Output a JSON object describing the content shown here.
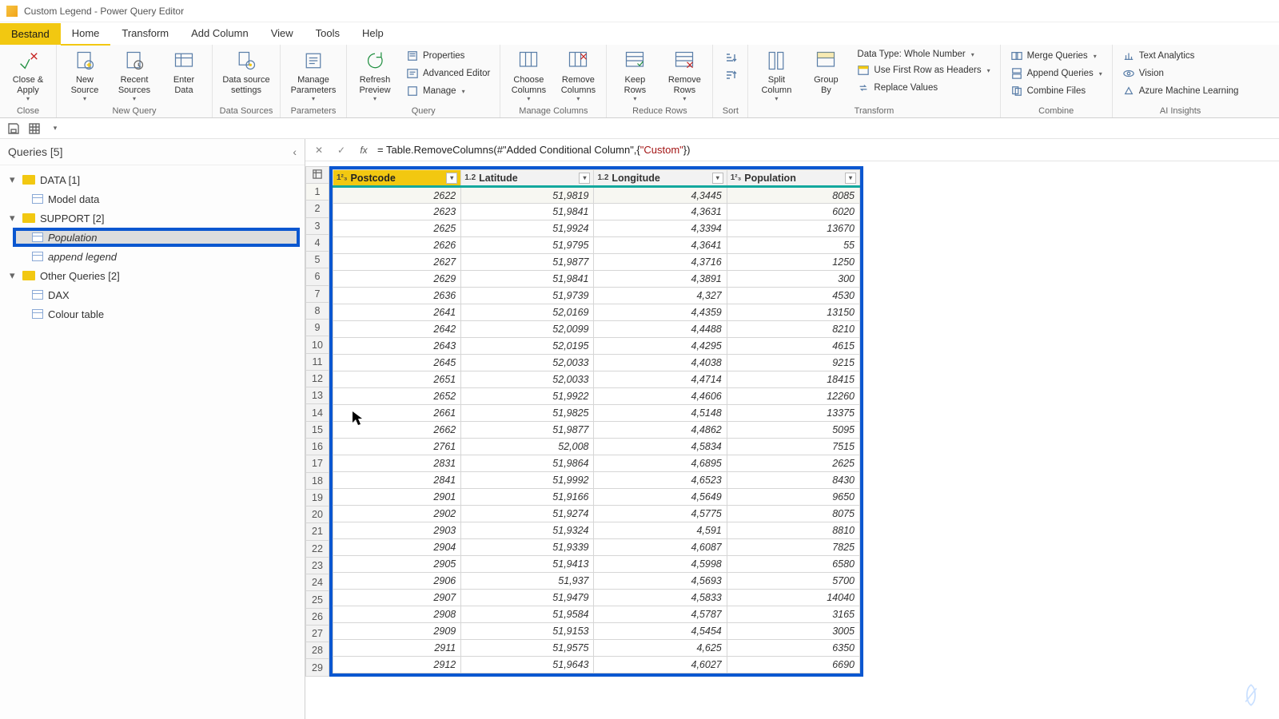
{
  "window": {
    "title": "Custom Legend - Power Query Editor"
  },
  "menu": {
    "file": "Bestand",
    "items": [
      "Home",
      "Transform",
      "Add Column",
      "View",
      "Tools",
      "Help"
    ],
    "active_index": 0
  },
  "ribbon": {
    "close": {
      "close_apply": "Close &\nApply",
      "group_label": "Close"
    },
    "new_query": {
      "new_source": "New\nSource",
      "recent_sources": "Recent\nSources",
      "enter_data": "Enter\nData",
      "group_label": "New Query"
    },
    "data_sources": {
      "settings": "Data source\nsettings",
      "group_label": "Data Sources"
    },
    "parameters": {
      "manage": "Manage\nParameters",
      "group_label": "Parameters"
    },
    "query": {
      "refresh": "Refresh\nPreview",
      "properties": "Properties",
      "advanced": "Advanced Editor",
      "manage": "Manage",
      "group_label": "Query"
    },
    "manage_columns": {
      "choose": "Choose\nColumns",
      "remove": "Remove\nColumns",
      "group_label": "Manage Columns"
    },
    "reduce_rows": {
      "keep": "Keep\nRows",
      "remove": "Remove\nRows",
      "group_label": "Reduce Rows"
    },
    "sort": {
      "group_label": "Sort"
    },
    "transform": {
      "split": "Split\nColumn",
      "group_by": "Group\nBy",
      "data_type": "Data Type: Whole Number",
      "first_row": "Use First Row as Headers",
      "replace": "Replace Values",
      "group_label": "Transform"
    },
    "combine": {
      "merge": "Merge Queries",
      "append": "Append Queries",
      "combine_files": "Combine Files",
      "group_label": "Combine"
    },
    "ai": {
      "text": "Text Analytics",
      "vision": "Vision",
      "ml": "Azure Machine Learning",
      "group_label": "AI Insights"
    }
  },
  "queries_pane": {
    "title": "Queries [5]",
    "groups": [
      {
        "label": "DATA [1]",
        "expanded": true,
        "items": [
          {
            "label": "Model data",
            "italic": false
          }
        ]
      },
      {
        "label": "SUPPORT [2]",
        "expanded": true,
        "items": [
          {
            "label": "Population",
            "italic": true,
            "selected": true
          },
          {
            "label": "append legend",
            "italic": true
          }
        ]
      },
      {
        "label": "Other Queries [2]",
        "expanded": true,
        "items": [
          {
            "label": "DAX",
            "italic": false
          },
          {
            "label": "Colour table",
            "italic": false
          }
        ]
      }
    ]
  },
  "formula": {
    "prefix": "= Table.RemoveColumns(#\"Added Conditional Column\",{",
    "string_literal": "\"Custom\"",
    "suffix": "})"
  },
  "grid": {
    "columns": [
      {
        "name": "Postcode",
        "type": "int",
        "selected": true
      },
      {
        "name": "Latitude",
        "type": "dec"
      },
      {
        "name": "Longitude",
        "type": "dec"
      },
      {
        "name": "Population",
        "type": "int"
      }
    ],
    "type_labels": {
      "int": "1²₃",
      "dec": "1.2"
    }
  },
  "chart_data": {
    "type": "table",
    "title": "Population",
    "columns": [
      "Postcode",
      "Latitude",
      "Longitude",
      "Population"
    ],
    "rows": [
      [
        "2622",
        "51,9819",
        "4,3445",
        "8085"
      ],
      [
        "2623",
        "51,9841",
        "4,3631",
        "6020"
      ],
      [
        "2625",
        "51,9924",
        "4,3394",
        "13670"
      ],
      [
        "2626",
        "51,9795",
        "4,3641",
        "55"
      ],
      [
        "2627",
        "51,9877",
        "4,3716",
        "1250"
      ],
      [
        "2629",
        "51,9841",
        "4,3891",
        "300"
      ],
      [
        "2636",
        "51,9739",
        "4,327",
        "4530"
      ],
      [
        "2641",
        "52,0169",
        "4,4359",
        "13150"
      ],
      [
        "2642",
        "52,0099",
        "4,4488",
        "8210"
      ],
      [
        "2643",
        "52,0195",
        "4,4295",
        "4615"
      ],
      [
        "2645",
        "52,0033",
        "4,4038",
        "9215"
      ],
      [
        "2651",
        "52,0033",
        "4,4714",
        "18415"
      ],
      [
        "2652",
        "51,9922",
        "4,4606",
        "12260"
      ],
      [
        "2661",
        "51,9825",
        "4,5148",
        "13375"
      ],
      [
        "2662",
        "51,9877",
        "4,4862",
        "5095"
      ],
      [
        "2761",
        "52,008",
        "4,5834",
        "7515"
      ],
      [
        "2831",
        "51,9864",
        "4,6895",
        "2625"
      ],
      [
        "2841",
        "51,9992",
        "4,6523",
        "8430"
      ],
      [
        "2901",
        "51,9166",
        "4,5649",
        "9650"
      ],
      [
        "2902",
        "51,9274",
        "4,5775",
        "8075"
      ],
      [
        "2903",
        "51,9324",
        "4,591",
        "8810"
      ],
      [
        "2904",
        "51,9339",
        "4,6087",
        "7825"
      ],
      [
        "2905",
        "51,9413",
        "4,5998",
        "6580"
      ],
      [
        "2906",
        "51,937",
        "4,5693",
        "5700"
      ],
      [
        "2907",
        "51,9479",
        "4,5833",
        "14040"
      ],
      [
        "2908",
        "51,9584",
        "4,5787",
        "3165"
      ],
      [
        "2909",
        "51,9153",
        "4,5454",
        "3005"
      ],
      [
        "2911",
        "51,9575",
        "4,625",
        "6350"
      ],
      [
        "2912",
        "51,9643",
        "4,6027",
        "6690"
      ]
    ]
  }
}
